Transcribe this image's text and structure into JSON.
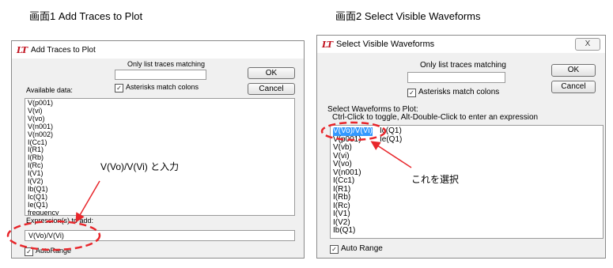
{
  "captions": {
    "left": "画面1   Add Traces to Plot",
    "right": "画面2   Select Visible Waveforms"
  },
  "dialog1": {
    "title": "Add Traces to Plot",
    "filter_label": "Only list traces matching",
    "filter_value": "",
    "asterisks_label": "Asterisks match colons",
    "asterisks_checked": true,
    "ok_label": "OK",
    "cancel_label": "Cancel",
    "available_label": "Available data:",
    "available_items": [
      "V(p001)",
      "V(vi)",
      "V(vo)",
      "V(n001)",
      "V(n002)",
      "I(Cc1)",
      "I(R1)",
      "I(Rb)",
      "I(Rc)",
      "I(V1)",
      "I(V2)",
      "Ib(Q1)",
      "Ic(Q1)",
      "Ie(Q1)",
      "frequency"
    ],
    "expression_label": "Expression(s) to add:",
    "expression_value": "V(Vo)/V(Vi)",
    "autorange_label": "AutoRange",
    "autorange_checked": true
  },
  "dialog2": {
    "title": "Select Visible Waveforms",
    "close_label": "X",
    "filter_label": "Only list traces matching",
    "filter_value": "",
    "asterisks_label": "Asterisks match colons",
    "asterisks_checked": true,
    "ok_label": "OK",
    "cancel_label": "Cancel",
    "select_label": "Select Waveforms to Plot:",
    "hint": "Ctrl-Click to toggle, Alt-Double-Click to enter an expression",
    "col1": [
      "V(Vo)/V(Vi)",
      "V(p001)",
      "V(vb)",
      "V(vi)",
      "V(vo)",
      "V(n001)",
      "I(Cc1)",
      "I(R1)",
      "I(Rb)",
      "I(Rc)",
      "I(V1)",
      "I(V2)",
      "Ib(Q1)"
    ],
    "col2": [
      "Ic(Q1)",
      "Ie(Q1)"
    ],
    "selected_item": "V(Vo)/V(Vi)",
    "autorange_label": "Auto Range",
    "autorange_checked": true
  },
  "annotations": {
    "input_note": "V(Vo)/V(Vi) と入力",
    "select_note": "これを選択"
  },
  "colors": {
    "annotation": "#e8262b",
    "selection": "#3399ff"
  }
}
